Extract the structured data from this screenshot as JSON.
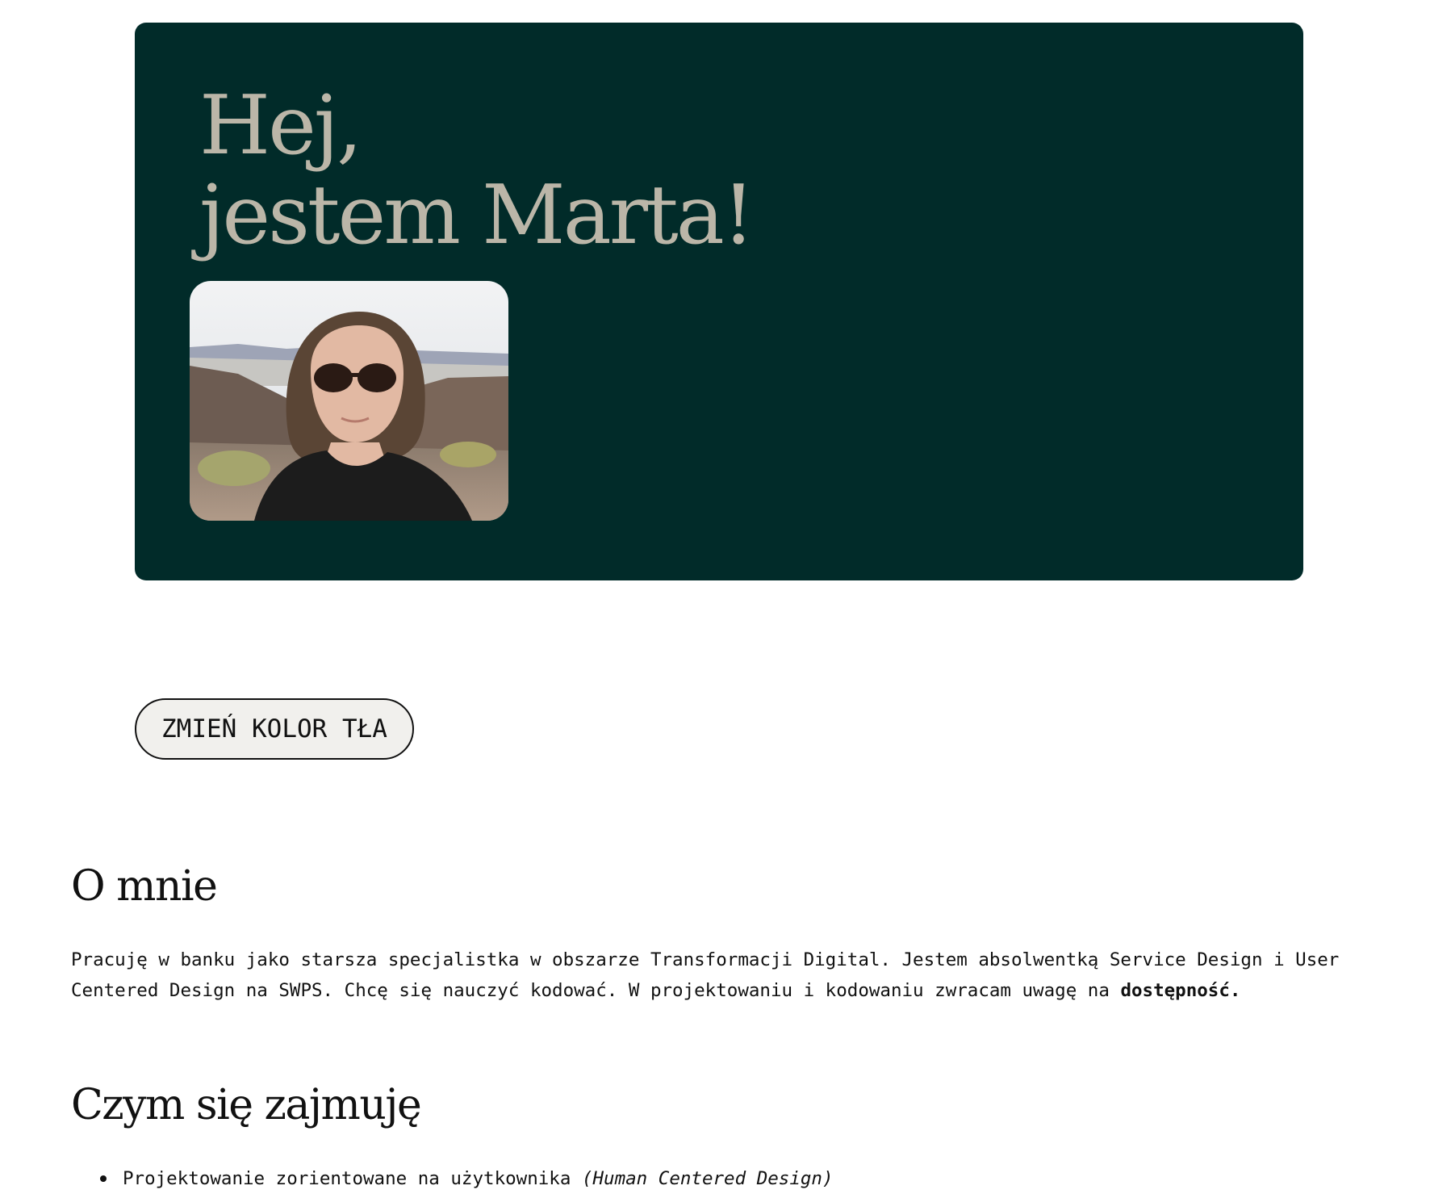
{
  "hero": {
    "title_line1": "Hej,",
    "title_line2": "jestem Marta!",
    "background": "#012b29",
    "title_color": "#bbb6a8"
  },
  "controls": {
    "change_bg_label": "ZMIEŃ KOLOR TŁA"
  },
  "about": {
    "heading": "O mnie",
    "line1": "Pracuję w banku jako starsza specjalistka w obszarze Transformacji Digital. Jestem absolwentką Service Design i User",
    "line2_prefix": "Centered Design na SWPS. Chcę się nauczyć kodować. W projektowaniu i kodowaniu zwracam uwagę na ",
    "line2_bold": "dostępność."
  },
  "work": {
    "heading": "Czym się zajmuję",
    "items": [
      {
        "text": "Projektowanie zorientowane na użytkownika ",
        "italic": "(Human Centered Design)"
      }
    ]
  }
}
